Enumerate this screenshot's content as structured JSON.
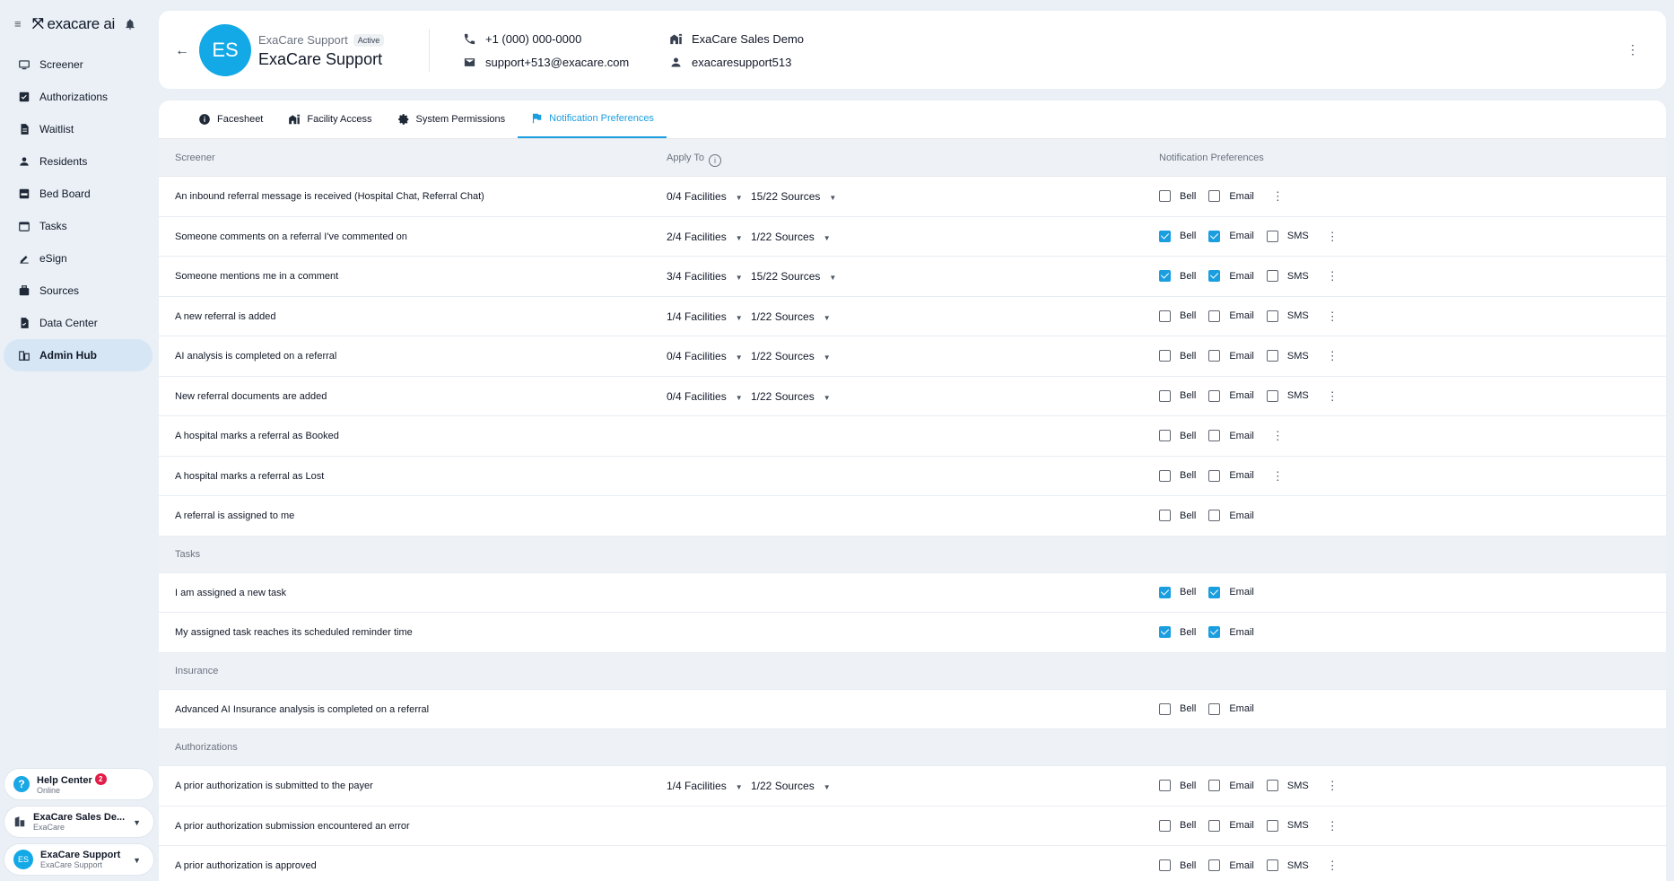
{
  "sidebar": {
    "brand": "exacare ai",
    "items": [
      {
        "label": "Screener",
        "icon": "screener-icon"
      },
      {
        "label": "Authorizations",
        "icon": "authorizations-icon"
      },
      {
        "label": "Waitlist",
        "icon": "waitlist-icon"
      },
      {
        "label": "Residents",
        "icon": "residents-icon"
      },
      {
        "label": "Bed Board",
        "icon": "bed-board-icon"
      },
      {
        "label": "Tasks",
        "icon": "tasks-icon"
      },
      {
        "label": "eSign",
        "icon": "esign-icon"
      },
      {
        "label": "Sources",
        "icon": "sources-icon"
      },
      {
        "label": "Data Center",
        "icon": "data-center-icon"
      },
      {
        "label": "Admin Hub",
        "icon": "admin-hub-icon",
        "active": true
      }
    ],
    "help": {
      "title": "Help Center",
      "badge": "2",
      "status": "Online"
    },
    "org": {
      "title": "ExaCare Sales De...",
      "subtitle": "ExaCare"
    },
    "user": {
      "initials": "ES",
      "title": "ExaCare Support",
      "subtitle": "ExaCare Support"
    }
  },
  "header": {
    "initials": "ES",
    "subtitle": "ExaCare Support",
    "status": "Active",
    "name": "ExaCare Support",
    "phone": "+1 (000) 000-0000",
    "email": "support+513@exacare.com",
    "facility": "ExaCare Sales Demo",
    "username": "exacaresupport513"
  },
  "tabs": [
    {
      "label": "Facesheet",
      "icon": "info-icon"
    },
    {
      "label": "Facility Access",
      "icon": "building-icon"
    },
    {
      "label": "System Permissions",
      "icon": "gear-icon"
    },
    {
      "label": "Notification Preferences",
      "icon": "flag-icon",
      "active": true
    }
  ],
  "table": {
    "col_screener": "Screener",
    "col_apply_to": "Apply To",
    "col_prefs": "Notification Preferences",
    "check_labels": {
      "bell": "Bell",
      "email": "Email",
      "sms": "SMS"
    },
    "screener_rows": [
      {
        "label": "An inbound referral message is received (Hospital Chat, Referral Chat)",
        "facilities": "0/4 Facilities",
        "sources": "15/22 Sources",
        "bell": false,
        "email": false,
        "sms": null,
        "menu": true
      },
      {
        "label": "Someone comments on a referral I've commented on",
        "facilities": "2/4 Facilities",
        "sources": "1/22 Sources",
        "bell": true,
        "email": true,
        "sms": false,
        "menu": true
      },
      {
        "label": "Someone mentions me in a comment",
        "facilities": "3/4 Facilities",
        "sources": "15/22 Sources",
        "bell": true,
        "email": true,
        "sms": false,
        "menu": true
      },
      {
        "label": "A new referral is added",
        "facilities": "1/4 Facilities",
        "sources": "1/22 Sources",
        "bell": false,
        "email": false,
        "sms": false,
        "menu": true
      },
      {
        "label": "AI analysis is completed on a referral",
        "facilities": "0/4 Facilities",
        "sources": "1/22 Sources",
        "bell": false,
        "email": false,
        "sms": false,
        "menu": true
      },
      {
        "label": "New referral documents are added",
        "facilities": "0/4 Facilities",
        "sources": "1/22 Sources",
        "bell": false,
        "email": false,
        "sms": false,
        "menu": true
      },
      {
        "label": "A hospital marks a referral as Booked",
        "bell": false,
        "email": false,
        "sms": null,
        "menu": true
      },
      {
        "label": "A hospital marks a referral as Lost",
        "bell": false,
        "email": false,
        "sms": null,
        "menu": true
      },
      {
        "label": "A referral is assigned to me",
        "bell": false,
        "email": false,
        "sms": null,
        "menu": false
      }
    ],
    "tasks_section": "Tasks",
    "tasks_rows": [
      {
        "label": "I am assigned a new task",
        "bell": true,
        "email": true,
        "sms": null,
        "menu": false
      },
      {
        "label": "My assigned task reaches its scheduled reminder time",
        "bell": true,
        "email": true,
        "sms": null,
        "menu": false
      }
    ],
    "insurance_section": "Insurance",
    "insurance_rows": [
      {
        "label": "Advanced AI Insurance analysis is completed on a referral",
        "bell": false,
        "email": false,
        "sms": null,
        "menu": false
      }
    ],
    "auth_section": "Authorizations",
    "auth_rows": [
      {
        "label": "A prior authorization is submitted to the payer",
        "facilities": "1/4 Facilities",
        "sources": "1/22 Sources",
        "bell": false,
        "email": false,
        "sms": false,
        "menu": true
      },
      {
        "label": "A prior authorization submission encountered an error",
        "bell": false,
        "email": false,
        "sms": false,
        "menu": true
      },
      {
        "label": "A prior authorization is approved",
        "bell": false,
        "email": false,
        "sms": false,
        "menu": true
      }
    ]
  }
}
